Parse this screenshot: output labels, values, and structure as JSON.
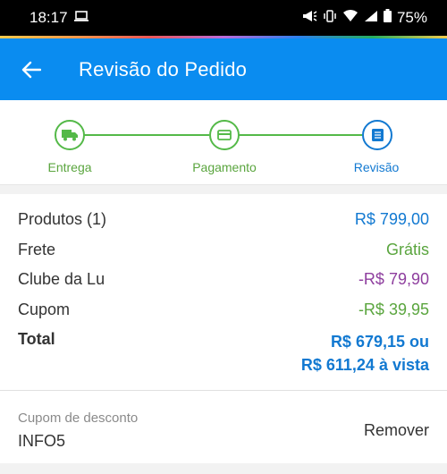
{
  "status_bar": {
    "time": "18:17",
    "battery": "75%"
  },
  "app_bar": {
    "title": "Revisão do Pedido"
  },
  "stepper": {
    "steps": [
      {
        "label": "Entrega",
        "icon": "truck-icon",
        "state": "done"
      },
      {
        "label": "Pagamento",
        "icon": "card-icon",
        "state": "done"
      },
      {
        "label": "Revisão",
        "icon": "list-icon",
        "state": "current"
      }
    ]
  },
  "summary": {
    "rows": [
      {
        "label": "Produtos (1)",
        "value": "R$ 799,00",
        "color": "#1279d1"
      },
      {
        "label": "Frete",
        "value": "Grátis",
        "color": "#5aa53e"
      },
      {
        "label": "Clube da Lu",
        "value": "-R$ 79,90",
        "color": "#8e3e9e"
      },
      {
        "label": "Cupom",
        "value": "-R$ 39,95",
        "color": "#5aa53e"
      }
    ],
    "total_label": "Total",
    "total_line1": "R$ 679,15 ou",
    "total_line2": "R$ 611,24 à vista"
  },
  "coupon": {
    "caption": "Cupom de desconto",
    "code": "INFO5",
    "remove_label": "Remover"
  },
  "colors": {
    "app_bar": "#0a8cf0",
    "step_done": "#54b948",
    "step_current": "#1279d1"
  }
}
